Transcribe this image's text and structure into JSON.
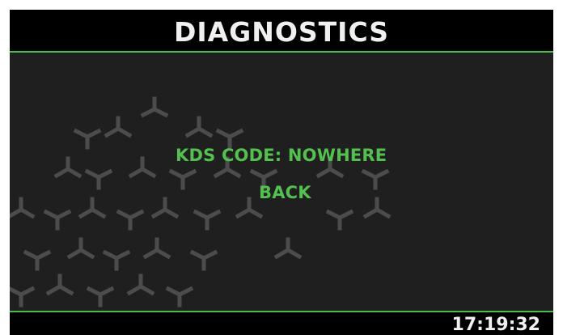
{
  "header": {
    "title": "DIAGNOSTICS"
  },
  "menu": {
    "items": [
      {
        "label": "KDS CODE:  NOWHERE"
      },
      {
        "label": "BACK"
      }
    ]
  },
  "status_bar": {
    "time": "17:19:32"
  },
  "colors": {
    "accent": "#54c04f",
    "background": "#1f1f1f",
    "bar": "#000000",
    "text": "#f0f0f0"
  },
  "decoration": {
    "icon": "hexagon-pattern-icon"
  }
}
